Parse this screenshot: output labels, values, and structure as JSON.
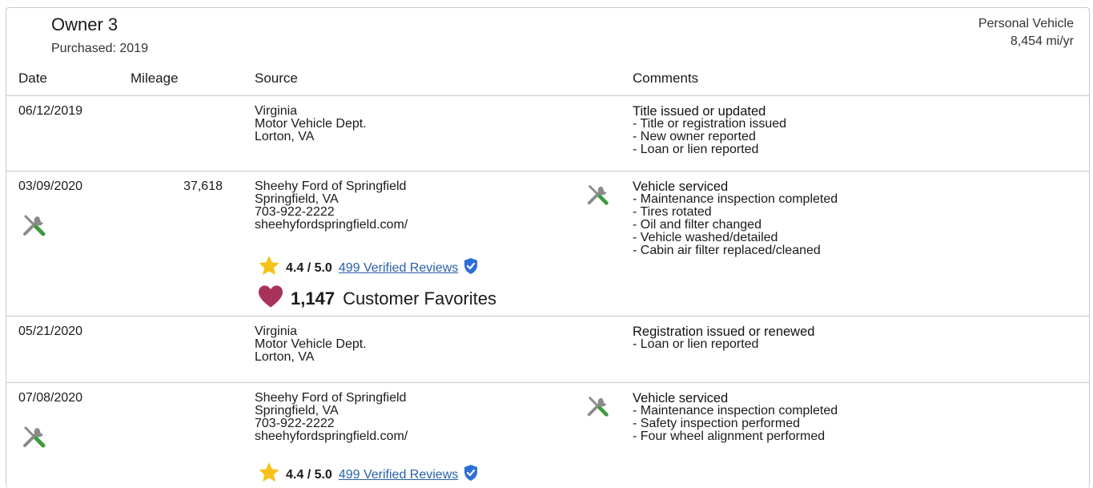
{
  "owner": {
    "title": "Owner 3",
    "purchased": "Purchased: 2019",
    "usage_type": "Personal Vehicle",
    "miles_per_year": "8,454 mi/yr"
  },
  "columns": {
    "date": "Date",
    "mileage": "Mileage",
    "source": "Source",
    "comments": "Comments"
  },
  "records": [
    {
      "date": "06/12/2019",
      "mileage": "",
      "source": [
        "Virginia",
        "Motor Vehicle Dept.",
        "Lorton, VA"
      ],
      "comment_title": "Title issued or updated",
      "comment_items": [
        "- Title or registration issued",
        "- New owner reported",
        "- Loan or lien reported"
      ]
    },
    {
      "date": "03/09/2020",
      "mileage": "37,618",
      "source": [
        "Sheehy Ford of Springfield",
        "Springfield, VA",
        "703-922-2222",
        "sheehyfordspringfield.com/"
      ],
      "rating": "4.4 / 5.0",
      "reviews_link": "499 Verified Reviews",
      "favorites_count": "1,147",
      "favorites_label": "Customer Favorites",
      "comment_title": "Vehicle serviced",
      "comment_items": [
        "- Maintenance inspection completed",
        "- Tires rotated",
        "- Oil and filter changed",
        "- Vehicle washed/detailed",
        "- Cabin air filter replaced/cleaned"
      ]
    },
    {
      "date": "05/21/2020",
      "mileage": "",
      "source": [
        "Virginia",
        "Motor Vehicle Dept.",
        "Lorton, VA"
      ],
      "comment_title": "Registration issued or renewed",
      "comment_items": [
        "- Loan or lien reported"
      ]
    },
    {
      "date": "07/08/2020",
      "mileage": "",
      "source": [
        "Sheehy Ford of Springfield",
        "Springfield, VA",
        "703-922-2222",
        "sheehyfordspringfield.com/"
      ],
      "rating": "4.4 / 5.0",
      "reviews_link": "499 Verified Reviews",
      "comment_title": "Vehicle serviced",
      "comment_items": [
        "- Maintenance inspection completed",
        "- Safety inspection performed",
        "- Four wheel alignment performed"
      ]
    }
  ],
  "colors": {
    "star": "#f6c21a",
    "heart": "#a8325a",
    "wrench": "#3d9a3d",
    "link": "#2a5fa8",
    "verified": "#2d6fd6"
  },
  "icons": [
    "service-tools-icon",
    "star-icon",
    "verified-badge-icon",
    "heart-icon"
  ]
}
